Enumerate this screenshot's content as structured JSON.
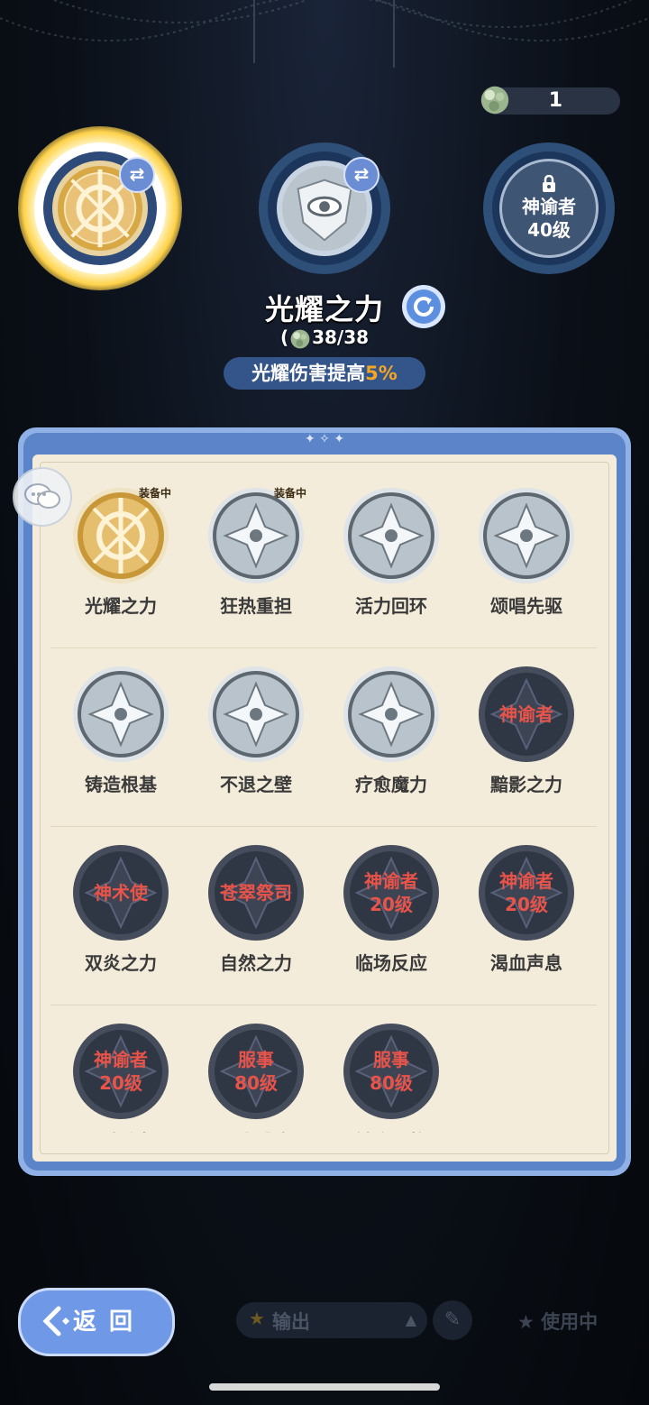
{
  "currency": {
    "icon": "stone-gem-icon",
    "value": "1"
  },
  "slots": [
    {
      "state": "equipped-active",
      "swap": "⇄"
    },
    {
      "state": "equipped",
      "swap": "⇄"
    },
    {
      "state": "locked",
      "lock_text_1": "神谕者",
      "lock_text_2": "40级"
    }
  ],
  "selected": {
    "title": "光耀之力",
    "count": "38/38",
    "count_prefix": "(",
    "buff_text": "光耀伤害提高",
    "buff_value": "5%"
  },
  "skills": [
    {
      "name": "光耀之力",
      "tag": "装备中",
      "style": "gold"
    },
    {
      "name": "狂热重担",
      "tag": "装备中",
      "style": "silver"
    },
    {
      "name": "活力回环",
      "tag": "",
      "style": "silver"
    },
    {
      "name": "颂唱先驱",
      "tag": "",
      "style": "silver"
    },
    {
      "name": "铸造根基",
      "tag": "",
      "style": "silver"
    },
    {
      "name": "不退之壁",
      "tag": "",
      "style": "silver"
    },
    {
      "name": "疗愈魔力",
      "tag": "",
      "style": "silver"
    },
    {
      "name": "黯影之力",
      "tag": "",
      "style": "locked",
      "lock1": "神谕者",
      "lock2": ""
    },
    {
      "name": "双炎之力",
      "tag": "",
      "style": "locked",
      "lock1": "神术使",
      "lock2": ""
    },
    {
      "name": "自然之力",
      "tag": "",
      "style": "locked",
      "lock1": "苍翠祭司",
      "lock2": ""
    },
    {
      "name": "临场反应",
      "tag": "",
      "style": "locked",
      "lock1": "神谕者",
      "lock2": "20级"
    },
    {
      "name": "渴血声息",
      "tag": "",
      "style": "locked",
      "lock1": "神谕者",
      "lock2": "20级"
    },
    {
      "name": "加速冷却",
      "tag": "",
      "style": "locked",
      "lock1": "神谕者",
      "lock2": "20级"
    },
    {
      "name": "无人感应",
      "tag": "",
      "style": "locked",
      "lock1": "服事",
      "lock2": "80级"
    },
    {
      "name": "触底升格",
      "tag": "",
      "style": "locked",
      "lock1": "服事",
      "lock2": "80级"
    }
  ],
  "bottom": {
    "back_label": "返回",
    "filter_label": "输出",
    "in_use_label": "使用中"
  },
  "colors": {
    "gold": "#e0a93a",
    "accent_blue": "#5c84c8",
    "highlight": "#f5a623",
    "lock_red": "#e8534a"
  }
}
